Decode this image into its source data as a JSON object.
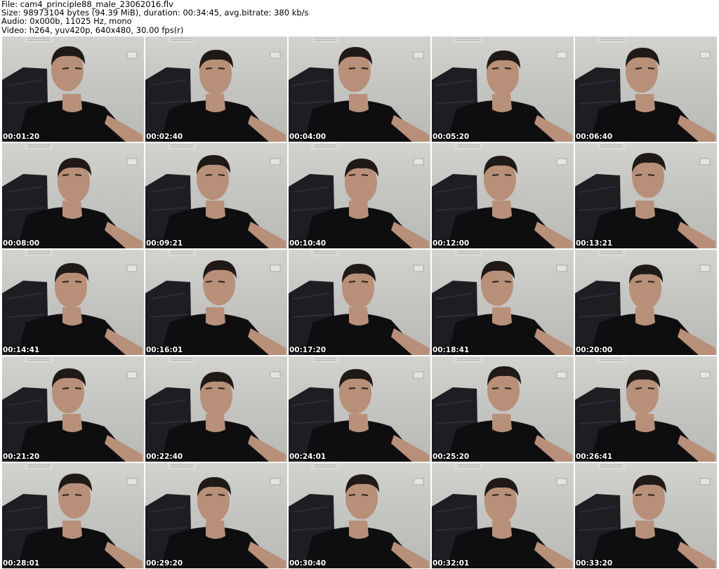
{
  "header": {
    "file_line": "File: cam4_principle88_male_23062016.flv",
    "size_line": "Size: 98973104 bytes (94.39 MiB), duration: 00:34:45, avg.bitrate: 380 kb/s",
    "audio_line": "Audio: 0x000b, 11025 Hz, mono",
    "video_line": "Video: h264, yuv420p, 640x480, 30.00 fps(r)"
  },
  "thumbnails": [
    {
      "time": "00:01:20"
    },
    {
      "time": "00:02:40"
    },
    {
      "time": "00:04:00"
    },
    {
      "time": "00:05:20"
    },
    {
      "time": "00:06:40"
    },
    {
      "time": "00:08:00"
    },
    {
      "time": "00:09:21"
    },
    {
      "time": "00:10:40"
    },
    {
      "time": "00:12:00"
    },
    {
      "time": "00:13:21"
    },
    {
      "time": "00:14:41"
    },
    {
      "time": "00:16:01"
    },
    {
      "time": "00:17:20"
    },
    {
      "time": "00:18:41"
    },
    {
      "time": "00:20:00"
    },
    {
      "time": "00:21:20"
    },
    {
      "time": "00:22:40"
    },
    {
      "time": "00:24:01"
    },
    {
      "time": "00:25:20"
    },
    {
      "time": "00:26:41"
    },
    {
      "time": "00:28:01"
    },
    {
      "time": "00:29:20"
    },
    {
      "time": "00:30:40"
    },
    {
      "time": "00:32:01"
    },
    {
      "time": "00:33:20"
    }
  ],
  "colors": {
    "wall": "#c8c8c5",
    "chair": "#1c1e22",
    "shirt": "#0e0e10",
    "skin": "#b88f78",
    "hair": "#201a17"
  }
}
